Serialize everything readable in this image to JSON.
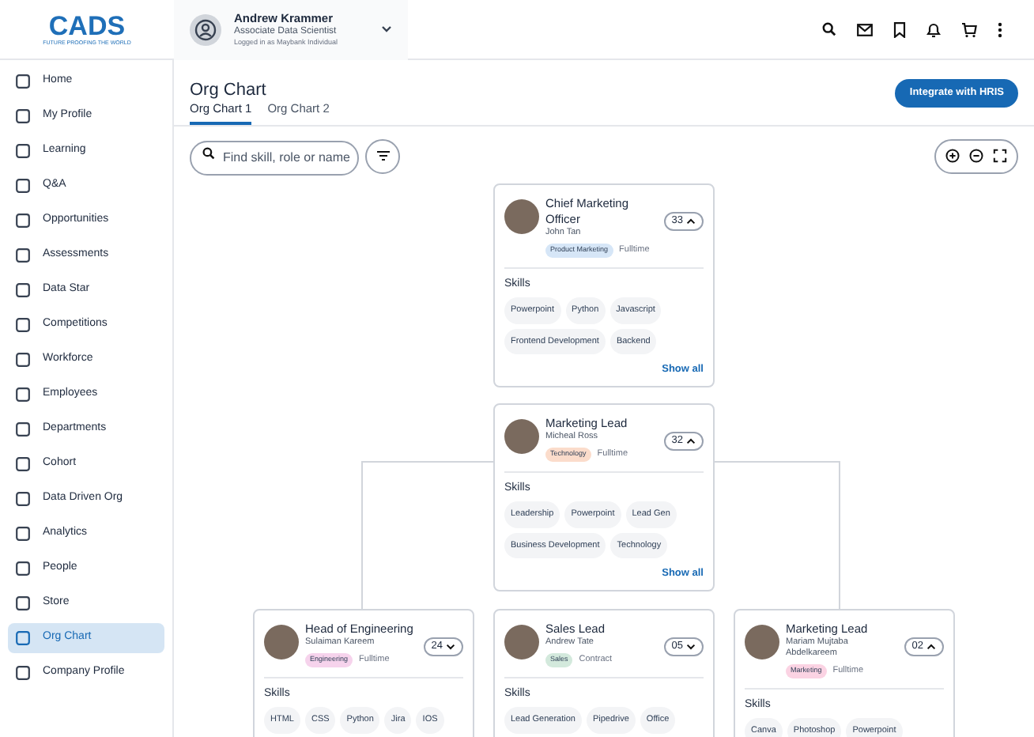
{
  "logo": {
    "text": "CADS",
    "tagline": "FUTURE PROOFING THE WORLD"
  },
  "user": {
    "name": "Andrew Krammer",
    "role": "Associate Data Scientist",
    "account": "Logged in as Maybank Individual"
  },
  "sidebar": {
    "items": [
      {
        "label": "Home",
        "selected": false
      },
      {
        "label": "My Profile",
        "selected": false
      },
      {
        "label": "Learning",
        "selected": false
      },
      {
        "label": "Q&A",
        "selected": false
      },
      {
        "label": "Opportunities",
        "selected": false
      },
      {
        "label": "Assessments",
        "selected": false
      },
      {
        "label": "Data Star",
        "selected": false
      },
      {
        "label": "Competitions",
        "selected": false
      },
      {
        "label": "Workforce",
        "selected": false
      },
      {
        "label": "Employees",
        "selected": false
      },
      {
        "label": "Departments",
        "selected": false
      },
      {
        "label": "Cohort",
        "selected": false
      },
      {
        "label": "Data Driven Org",
        "selected": false
      },
      {
        "label": "Analytics",
        "selected": false
      },
      {
        "label": "People",
        "selected": false
      },
      {
        "label": "Store",
        "selected": false
      },
      {
        "label": "Org Chart",
        "selected": true
      },
      {
        "label": "Company Profile",
        "selected": false
      }
    ]
  },
  "page": {
    "title": "Org Chart",
    "action_button": "Integrate with HRIS"
  },
  "tabs": [
    {
      "label": "Org Chart 1",
      "selected": true
    },
    {
      "label": "Org Chart 2",
      "selected": false
    }
  ],
  "search": {
    "placeholder": "Find skill, role or name"
  },
  "nodes": [
    {
      "title": "Chief Marketing Officer",
      "name": "John Tan",
      "count": "33",
      "expanded": true,
      "tag": "Product Marketing",
      "color": "#d6e6f7",
      "employment": "Fulltime",
      "skills_title": "Skills",
      "skills": [
        "Powerpoint",
        "Python",
        "Javascript",
        "Frontend Development",
        "Backend"
      ],
      "show_all": "Show all"
    },
    {
      "title": "Marketing Lead",
      "name": "Micheal Ross",
      "count": "32",
      "expanded": true,
      "tag": "Technology",
      "color": "#fbdccb",
      "employment": "Fulltime",
      "skills_title": "Skills",
      "skills": [
        "Leadership",
        "Powerpoint",
        "Lead Gen",
        "Business Development",
        "Technology"
      ],
      "show_all": "Show all"
    },
    {
      "title": "Head of Engineering",
      "name": "Sulaiman Kareem",
      "count": "24",
      "expanded": false,
      "tag": "Engineering",
      "color": "#f6d3ec",
      "employment": "Fulltime",
      "skills_title": "Skills",
      "skills": [
        "HTML",
        "CSS",
        "Python",
        "Jira",
        "IOS"
      ]
    },
    {
      "title": "Sales Lead",
      "name": "Andrew Tate",
      "count": "05",
      "expanded": false,
      "tag": "Sales",
      "color": "#d3e9dc",
      "employment": "Contract",
      "skills_title": "Skills",
      "skills": [
        "Lead Generation",
        "Pipedrive",
        "Office"
      ]
    },
    {
      "title": "Marketing Lead",
      "name": "Mariam Mujtaba Abdelkareem",
      "count": "02",
      "expanded": true,
      "tag": "Marketing",
      "color": "#fbd3e3",
      "employment": "Fulltime",
      "skills_title": "Skills",
      "skills": [
        "Canva",
        "Photoshop",
        "Powerpoint"
      ]
    }
  ]
}
